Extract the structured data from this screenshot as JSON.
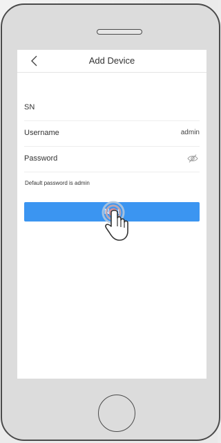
{
  "app": {
    "title": "Add Device"
  },
  "header": {
    "back_icon": "chevron-left-icon"
  },
  "form": {
    "sn_label": "SN",
    "sn_value": "",
    "username_label": "Username",
    "username_value": "admin",
    "password_label": "Password",
    "password_icon": "eye-hidden-icon",
    "hint": "Default password is admin"
  },
  "actions": {
    "next_label": "Next"
  },
  "colors": {
    "accent": "#3b95f1",
    "tap_ring": "#e08c8c"
  }
}
